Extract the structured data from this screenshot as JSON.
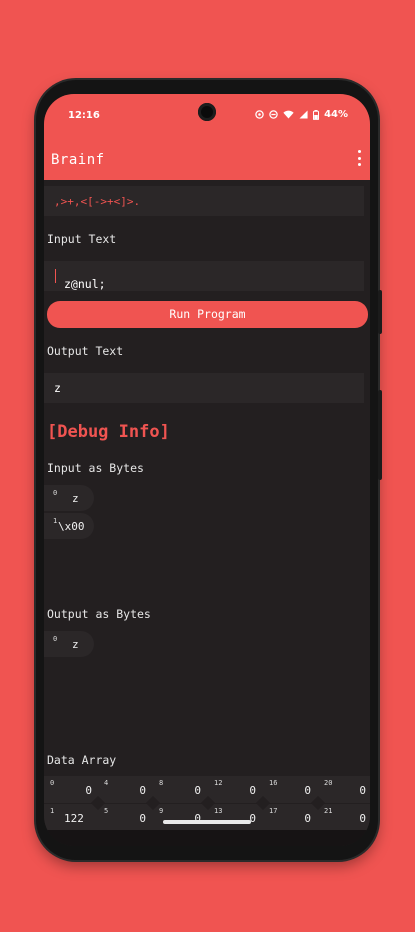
{
  "status": {
    "time": "12:16",
    "battery": "44%"
  },
  "appbar": {
    "title": "Brainf"
  },
  "program": {
    "code": ",>+,<[->+<]>."
  },
  "input": {
    "label": "Input Text",
    "value": "z@nul;"
  },
  "run_button": {
    "label": "Run Program"
  },
  "output": {
    "label": "Output Text",
    "value": "z"
  },
  "debug": {
    "title": "[Debug Info]",
    "input_bytes_label": "Input as Bytes",
    "input_bytes": [
      {
        "index": "0",
        "value": "z"
      },
      {
        "index": "1",
        "value": "\\x00"
      }
    ],
    "output_bytes_label": "Output as Bytes",
    "output_bytes": [
      {
        "index": "0",
        "value": "z"
      }
    ],
    "data_array_label": "Data Array",
    "data_array": [
      {
        "index": "0",
        "value": "0"
      },
      {
        "index": "4",
        "value": "0"
      },
      {
        "index": "8",
        "value": "0"
      },
      {
        "index": "12",
        "value": "0"
      },
      {
        "index": "16",
        "value": "0"
      },
      {
        "index": "20",
        "value": "0"
      },
      {
        "index": "1",
        "value": "122"
      },
      {
        "index": "5",
        "value": "0"
      },
      {
        "index": "9",
        "value": "0"
      },
      {
        "index": "13",
        "value": "0"
      },
      {
        "index": "17",
        "value": "0"
      },
      {
        "index": "21",
        "value": "0"
      }
    ]
  },
  "colors": {
    "accent": "#f05451",
    "background": "#231f20",
    "surface": "#2b2728"
  }
}
